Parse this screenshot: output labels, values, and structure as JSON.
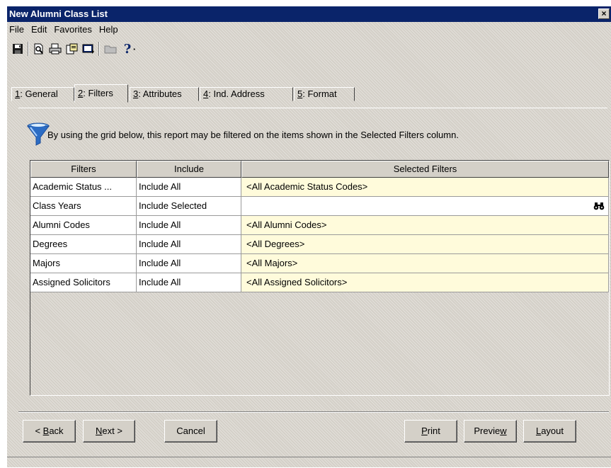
{
  "window": {
    "title": "New Alumni Class List",
    "close_label": "×"
  },
  "menu": [
    "File",
    "Edit",
    "Favorites",
    "Help"
  ],
  "toolbar": {
    "icons": [
      "save-icon",
      "print-preview-icon",
      "print-icon",
      "export-icon",
      "send-icon",
      "folder-icon",
      "help-icon"
    ],
    "help_label": "?",
    "dropdown_label": "·"
  },
  "tabs": [
    {
      "key": "1",
      "label": ": General"
    },
    {
      "key": "2",
      "label": ": Filters"
    },
    {
      "key": "3",
      "label": ": Attributes"
    },
    {
      "key": "4",
      "label": ": Ind. Address"
    },
    {
      "key": "5",
      "label": ": Format"
    }
  ],
  "active_tab": "2",
  "info": {
    "text": "By using the grid below, this report may be filtered on the items shown in the Selected Filters column."
  },
  "grid": {
    "columns": [
      "Filters",
      "Include",
      "Selected Filters"
    ],
    "rows": [
      {
        "filter": "Academic Status ...",
        "include": "Include All",
        "selected": "<All Academic Status Codes>"
      },
      {
        "filter": "Class Years",
        "include": "Include Selected",
        "selected": ""
      },
      {
        "filter": "Alumni Codes",
        "include": "Include All",
        "selected": "<All Alumni Codes>"
      },
      {
        "filter": "Degrees",
        "include": "Include All",
        "selected": "<All Degrees>"
      },
      {
        "filter": "Majors",
        "include": "Include All",
        "selected": "<All Majors>"
      },
      {
        "filter": "Assigned Solicitors",
        "include": "Include All",
        "selected": "<All Assigned Solicitors>"
      }
    ]
  },
  "buttons": {
    "back": {
      "prefix": "< ",
      "accel": "B",
      "rest": "ack"
    },
    "next": {
      "accel": "N",
      "rest": "ext >"
    },
    "cancel": "Cancel",
    "print": {
      "accel": "P",
      "rest": "rint"
    },
    "preview": {
      "pre": "Previe",
      "accel": "w"
    },
    "layout": {
      "accel": "L",
      "rest": "ayout"
    }
  },
  "colors": {
    "titlebar": "#0a246a",
    "face": "#d4d0c8",
    "selected_cell": "#fffbdb"
  }
}
